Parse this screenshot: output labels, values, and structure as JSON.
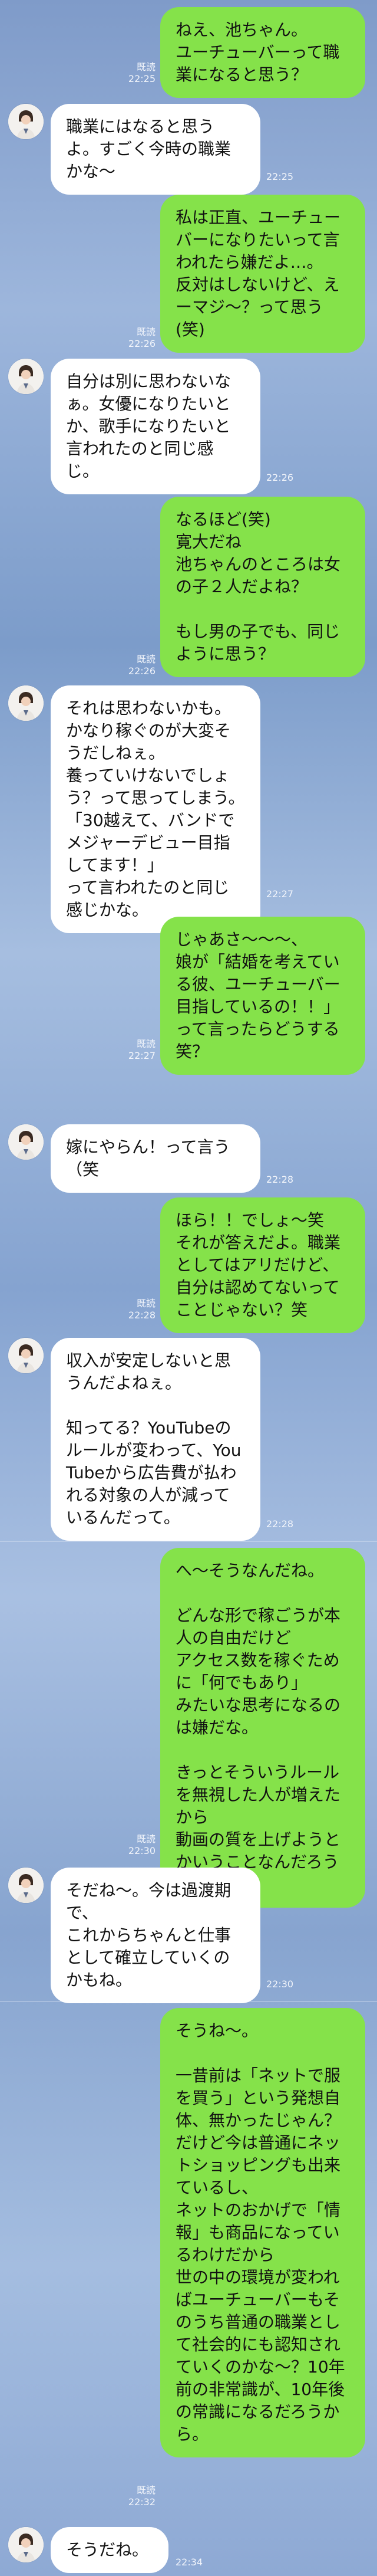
{
  "chat": {
    "messages": [
      {
        "side": "sent",
        "text": "ねえ、池ちゃん。\nユーチューバーって職業になると思う？",
        "read": "既読",
        "time": "22:25"
      },
      {
        "side": "recv",
        "text": "職業にはなると思うよ。すごく今時の職業かな〜",
        "time": "22:25"
      },
      {
        "side": "sent",
        "text": "私は正直、ユーチューバーになりたいって言われたら嫌だよ…。\n反対はしないけど、えーマジ〜？って思う(笑)",
        "read": "既読",
        "time": "22:26"
      },
      {
        "side": "recv",
        "text": "自分は別に思わないなぁ。女優になりたいとか、歌手になりたいと言われたのと同じ感じ。",
        "time": "22:26"
      },
      {
        "side": "sent",
        "text": "なるほど(笑)\n寛大だね\n池ちゃんのところは女の子２人だよね？\n\nもし男の子でも、同じように思う？",
        "read": "既読",
        "time": "22:26"
      },
      {
        "side": "recv",
        "text": "それは思わないかも。\nかなり稼ぐのが大変そうだしねぇ。\n養っていけないでしょう？って思ってしまう。\n「30越えて、バンドでメジャーデビュー目指してます！」\nって言われたのと同じ感じかな。",
        "time": "22:27"
      },
      {
        "side": "sent",
        "text": "じゃあさ〜〜〜、\n娘が「結婚を考えている彼、ユーチューバー目指しているの！！」って言ったらどうする笑？",
        "read": "既読",
        "time": "22:27"
      },
      {
        "side": "recv",
        "text": "嫁にやらん！って言う（笑",
        "time": "22:28"
      },
      {
        "side": "sent",
        "text": "ほら！！でしょ〜笑\nそれが答えだよ。職業としてはアリだけど、自分は認めてないってことじゃない？笑",
        "read": "既読",
        "time": "22:28"
      },
      {
        "side": "recv",
        "text": "収入が安定しないと思うんだよねぇ。\n\n知ってる？YouTubeのルールが変わって、YouTubeから広告費が払われる対象の人が減っているんだって。",
        "time": "22:28"
      },
      {
        "side": "sent",
        "text": "へ〜そうなんだね。\n\nどんな形で稼ごうが本人の自由だけど\nアクセス数を稼ぐために「何でもあり」\nみたいな思考になるのは嫌だな。\n\nきっとそういうルールを無視した人が増えたから\n動画の質を上げようとかいうことなんだろうね〜。",
        "read": "既読",
        "time": "22:30"
      },
      {
        "side": "recv",
        "text": "そだね〜。今は過渡期で、\nこれからちゃんと仕事として確立していくのかもね。",
        "time": "22:30"
      },
      {
        "side": "sent",
        "text": "そうね〜。\n\n一昔前は「ネットで服を買う」という発想自体、無かったじゃん？\nだけど今は普通にネットショッピングも出来ているし、\nネットのおかげで「情報」も商品になっているわけだから\n世の中の環境が変わればユーチューバーもそのうち普通の職業として社会的にも認知されていくのかな〜？10年前の非常識が、10年後の常識になるだろうから。",
        "read": "既読",
        "time": "22:32"
      },
      {
        "side": "recv",
        "text": "そうだね。",
        "time": "22:34"
      }
    ]
  }
}
